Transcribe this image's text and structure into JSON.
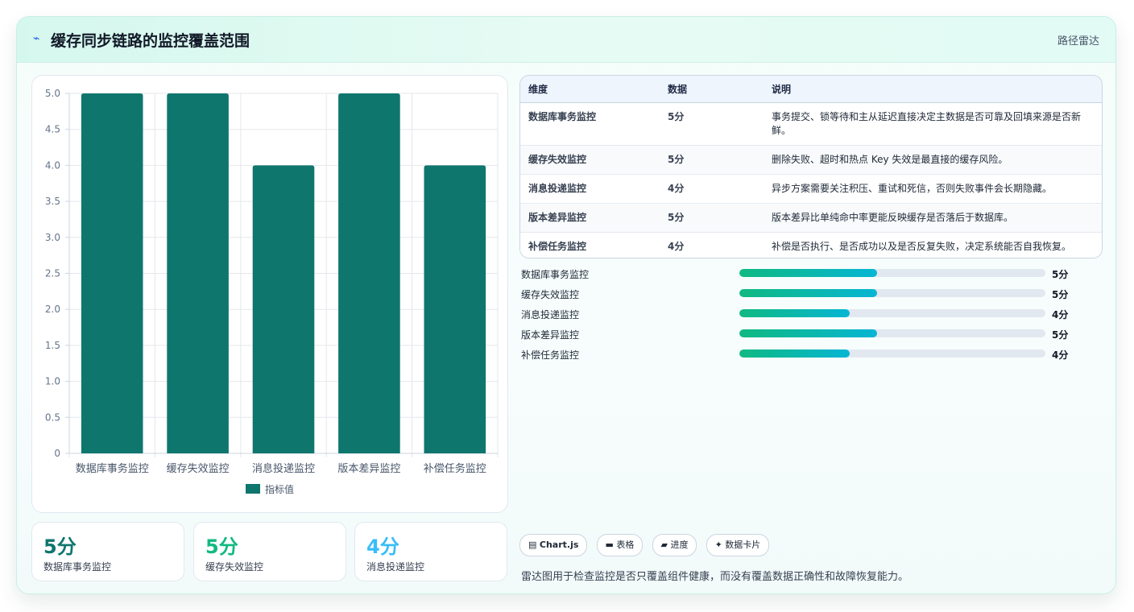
{
  "header": {
    "title": "缓存同步链路的监控覆盖范围",
    "tag": "路径雷达",
    "icon": "bolt-icon"
  },
  "chart_data": {
    "type": "bar",
    "categories": [
      "数据库事务监控",
      "缓存失效监控",
      "消息投递监控",
      "版本差异监控",
      "补偿任务监控"
    ],
    "series": [
      {
        "name": "指标值",
        "values": [
          5,
          5,
          4,
          5,
          4
        ],
        "color": "#0f766e"
      }
    ],
    "ylim": [
      0,
      5
    ],
    "yticks": [
      0,
      0.5,
      1,
      1.5,
      2,
      2.5,
      3,
      3.5,
      4,
      4.5,
      5
    ],
    "ytick_labels": [
      "0",
      "0.5",
      "1.0",
      "1.5",
      "2.0",
      "2.5",
      "3.0",
      "3.5",
      "4.0",
      "4.5",
      "5.0"
    ],
    "grid": true,
    "legend": "bottom"
  },
  "table": {
    "headers": [
      "维度",
      "数据",
      "说明"
    ],
    "rows": [
      [
        "数据库事务监控",
        "5分",
        "事务提交、锁等待和主从延迟直接决定主数据是否可靠及回填来源是否新鲜。"
      ],
      [
        "缓存失效监控",
        "5分",
        "删除失败、超时和热点 Key 失效是最直接的缓存风险。"
      ],
      [
        "消息投递监控",
        "4分",
        "异步方案需要关注积压、重试和死信，否则失败事件会长期隐藏。"
      ],
      [
        "版本差异监控",
        "5分",
        "版本差异比单纯命中率更能反映缓存是否落后于数据库。"
      ],
      [
        "补偿任务监控",
        "4分",
        "补偿是否执行、是否成功以及是否反复失败，决定系统能否自我恢复。"
      ]
    ]
  },
  "progress": {
    "max": 5,
    "items": [
      {
        "label": "数据库事务监控",
        "value": 5,
        "text": "5分"
      },
      {
        "label": "缓存失效监控",
        "value": 5,
        "text": "5分"
      },
      {
        "label": "消息投递监控",
        "value": 4,
        "text": "4分"
      },
      {
        "label": "版本差异监控",
        "value": 5,
        "text": "5分"
      },
      {
        "label": "补偿任务监控",
        "value": 4,
        "text": "4分"
      }
    ]
  },
  "kpis": [
    {
      "value": "5分",
      "label": "数据库事务监控",
      "color": "#0f766e"
    },
    {
      "value": "5分",
      "label": "缓存失效监控",
      "color": "#10b981"
    },
    {
      "value": "4分",
      "label": "消息投递监控",
      "color": "#38bdf8"
    }
  ],
  "chips": [
    {
      "icon": "chart-icon",
      "label": "Chart.js"
    },
    {
      "icon": "table-icon",
      "label": "表格"
    },
    {
      "icon": "progress-icon",
      "label": "进度"
    },
    {
      "icon": "sparkle-icon",
      "label": "数据卡片"
    }
  ],
  "note": "雷达图用于检查监控是否只覆盖组件健康，而没有覆盖数据正确性和故障恢复能力。"
}
